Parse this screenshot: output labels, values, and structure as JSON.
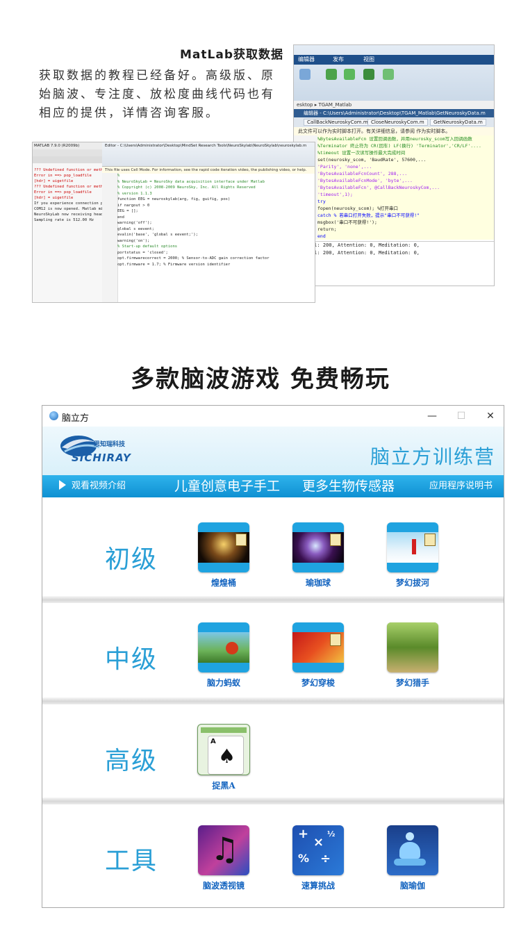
{
  "matlab": {
    "title": "MatLab获取数据",
    "description": "获取数据的教程已经备好。高级版、原始脑波、专注度、放松度曲线代码也有相应的提供，详情咨询客服。"
  },
  "screenshot_right": {
    "tabs_top": [
      "编辑器",
      "发布",
      "视图"
    ],
    "path": "esktop ▸ TGAM_Matlab",
    "editor_title": "编辑器 - C:\\Users\\Administrator\\Desktop\\TGAM_Matlab\\GetNeuroskyData.m",
    "file_tabs": [
      "CallBackNeuroskyCom.m",
      "CloseNeuroskyCom.m",
      "GetNeuroskyData.m"
    ],
    "notice": "此文件可以作为实时脚本打开。有关详细信息，请参阅 作为实时脚本。",
    "code_lines": [
      "%BytesAvailableFcn 设置回调函数，并用neurosky_scom写入回调函数",
      "%Terminator 终止符为 CR(回车) LF(换行)   'Terminator','CR/LF'....",
      "%timeout 设置一次读写操作最大完成时间",
      "set(neurosky_scom, 'BaudRate', 57600,...",
      "    'Parity', 'none',...",
      "    'BytesAvailableFcnCount', 288,...",
      "    'BytesAvailableFcnMode', 'byte',...",
      "    'BytesAvailableFcn', @CallBackNeuroskyCom,...",
      "    'timeout',1);",
      "",
      "try",
      "    fopen(neurosky_scom);  %打开串口",
      "catch  % 若串口打开失败，提示\"串口不可获得!\"",
      "    msgbox('串口不可获得!');",
      "    return;",
      "end"
    ],
    "cmd_lines": [
      "riginal: 200, Attention: 0, Meditation: 0,",
      "riginal: 200, Attention: 0, Meditation: 0,"
    ]
  },
  "screenshot_left": {
    "app_title": "MATLAB 7.9.0 (R2009b)",
    "editor_title": "Editor - C:\\Users\\Administrator\\Desktop\\MindSet Research Tools\\NeuroSkylab\\NeuroSkylab\\neuroskylab.m",
    "info": "This file uses Cell Mode. For information, see the rapid code iteration video, the publishing video, or help.",
    "left_lines": [
      "??? Undefined function or method",
      "Error in ==> pop_loadfile",
      "    [hdr] = uigetfile",
      "??? Undefined function or method",
      "Error in ==> pop_loadfile",
      "    [hdr] = uigetfile",
      "If you experience connection pro",
      "COM12 is now opened. Matlab migh",
      "NeuroSkyLab now receiving heads",
      "Sampling rate is 512.00 Hz"
    ],
    "code_lines": [
      "%",
      "% NeuroSkyLab = NeuroSky data acquisition interface under Matlab",
      "% Copyright (c) 2008-2009 NeuroSky, Inc. All Rights Reserved",
      "",
      "% version 1.1.3",
      "",
      "function EEG = neuroskylab(arg, fig, guifig, pos)",
      "",
      "if nargout > 0",
      "    EEG = [];",
      "end",
      "warning('off');",
      "global s eevent;",
      "evalin('base', 'global s eevent;');",
      "warning('on');",
      "",
      "% Start-up default options",
      "portstatus = 'closed';",
      "",
      "opt.firmwarecorrect = 2000;  % Sensor-to-ADC gain correction factor",
      "opt.firmware        = 1.7;   % Firmware version identifier"
    ]
  },
  "section_title": "多款脑波游戏  免费畅玩",
  "app": {
    "window_title": "脑立方",
    "controls": [
      "—",
      "☐",
      "✕"
    ],
    "logo_text": "SICHIRAY",
    "logo_subtext": "思知瑞科技",
    "brand": "脑立方训练营",
    "nav": {
      "video": "观看视频介绍",
      "craft": "儿童创意电子手工",
      "sensors": "更多生物传感器",
      "manual": "应用程序说明书"
    },
    "levels": [
      {
        "label": "初级",
        "games": [
          "煌煌桶",
          "瑜珈球",
          "梦幻拔河"
        ]
      },
      {
        "label": "中级",
        "games": [
          "脑力蚂蚁",
          "梦幻穿梭",
          "梦幻猎手"
        ]
      },
      {
        "label": "高级",
        "games": [
          "捉黑A"
        ]
      },
      {
        "label": "工具",
        "games": [
          "脑波透视镜",
          "速算挑战",
          "脑瑜伽"
        ]
      }
    ]
  },
  "colors": {
    "accent": "#2a9fd6",
    "nav_bar": "#1ba2e2",
    "game_label": "#1565c0"
  }
}
